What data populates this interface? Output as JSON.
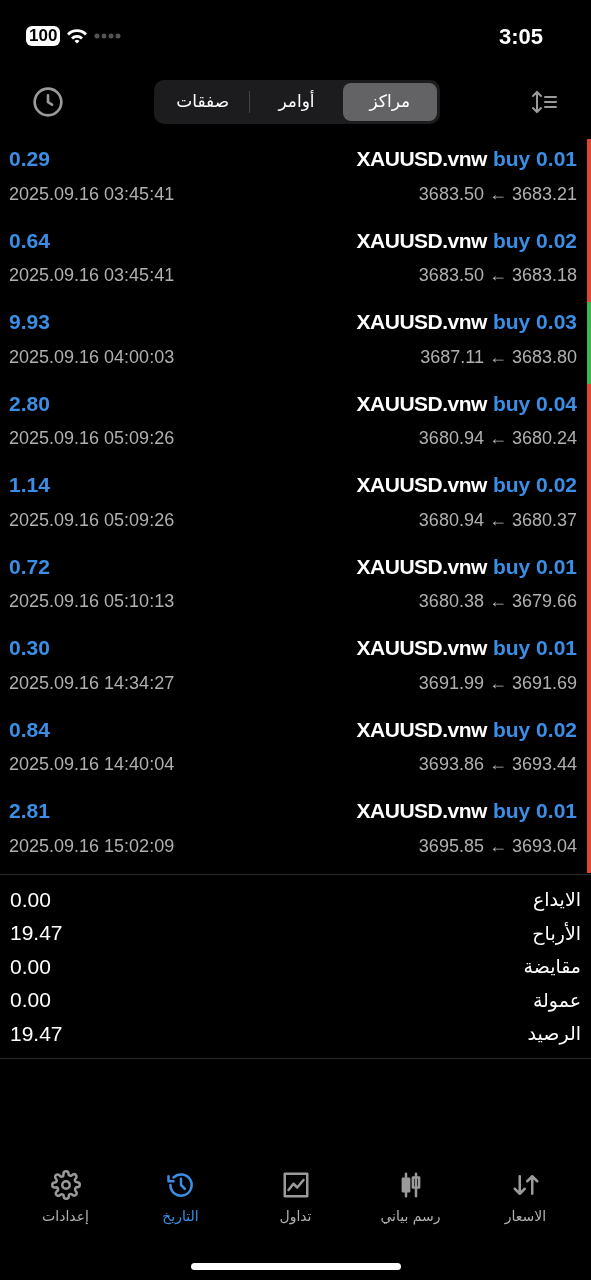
{
  "status_bar": {
    "time": "3:05",
    "battery": "100"
  },
  "tabs": [
    {
      "label": "مراكز",
      "selected": true
    },
    {
      "label": "أوامر",
      "selected": false
    },
    {
      "label": "صفقات",
      "selected": false
    }
  ],
  "positions": [
    {
      "symbol": "XAUUSD.vnw",
      "side": "buy 0.01",
      "prices": "3683.50 ← 3683.21",
      "profit": "0.29",
      "time": "2025.09.16 03:45:41",
      "color": "#e0452f"
    },
    {
      "symbol": "XAUUSD.vnw",
      "side": "buy 0.02",
      "prices": "3683.50 ← 3683.18",
      "profit": "0.64",
      "time": "2025.09.16 03:45:41",
      "color": "#e0452f"
    },
    {
      "symbol": "XAUUSD.vnw",
      "side": "buy 0.03",
      "prices": "3687.11 ← 3683.80",
      "profit": "9.93",
      "time": "2025.09.16 04:00:03",
      "color": "#3cb64a"
    },
    {
      "symbol": "XAUUSD.vnw",
      "side": "buy 0.04",
      "prices": "3680.94 ← 3680.24",
      "profit": "2.80",
      "time": "2025.09.16 05:09:26",
      "color": "#e0452f"
    },
    {
      "symbol": "XAUUSD.vnw",
      "side": "buy 0.02",
      "prices": "3680.94 ← 3680.37",
      "profit": "1.14",
      "time": "2025.09.16 05:09:26",
      "color": "#e0452f"
    },
    {
      "symbol": "XAUUSD.vnw",
      "side": "buy 0.01",
      "prices": "3680.38 ← 3679.66",
      "profit": "0.72",
      "time": "2025.09.16 05:10:13",
      "color": "#e0452f"
    },
    {
      "symbol": "XAUUSD.vnw",
      "side": "buy 0.01",
      "prices": "3691.99 ← 3691.69",
      "profit": "0.30",
      "time": "2025.09.16 14:34:27",
      "color": "#e0452f"
    },
    {
      "symbol": "XAUUSD.vnw",
      "side": "buy 0.02",
      "prices": "3693.86 ← 3693.44",
      "profit": "0.84",
      "time": "2025.09.16 14:40:04",
      "color": "#e0452f"
    },
    {
      "symbol": "XAUUSD.vnw",
      "side": "buy 0.01",
      "prices": "3695.85 ← 3693.04",
      "profit": "2.81",
      "time": "2025.09.16 15:02:09",
      "color": "#e0452f"
    }
  ],
  "summary": [
    {
      "label": "الايداع",
      "value": "0.00"
    },
    {
      "label": "الأرباح",
      "value": "19.47"
    },
    {
      "label": "مقايضة",
      "value": "0.00"
    },
    {
      "label": "عمولة",
      "value": "0.00"
    },
    {
      "label": "الرصيد",
      "value": "19.47"
    }
  ],
  "nav": [
    {
      "kind": "quotes",
      "label": "الاسعار",
      "selected": false
    },
    {
      "kind": "chart",
      "label": "رسم بياني",
      "selected": false
    },
    {
      "kind": "trade",
      "label": "تداول",
      "selected": false
    },
    {
      "kind": "history",
      "label": "التاريخ",
      "selected": true
    },
    {
      "kind": "settings",
      "label": "إعدادات",
      "selected": false
    }
  ]
}
